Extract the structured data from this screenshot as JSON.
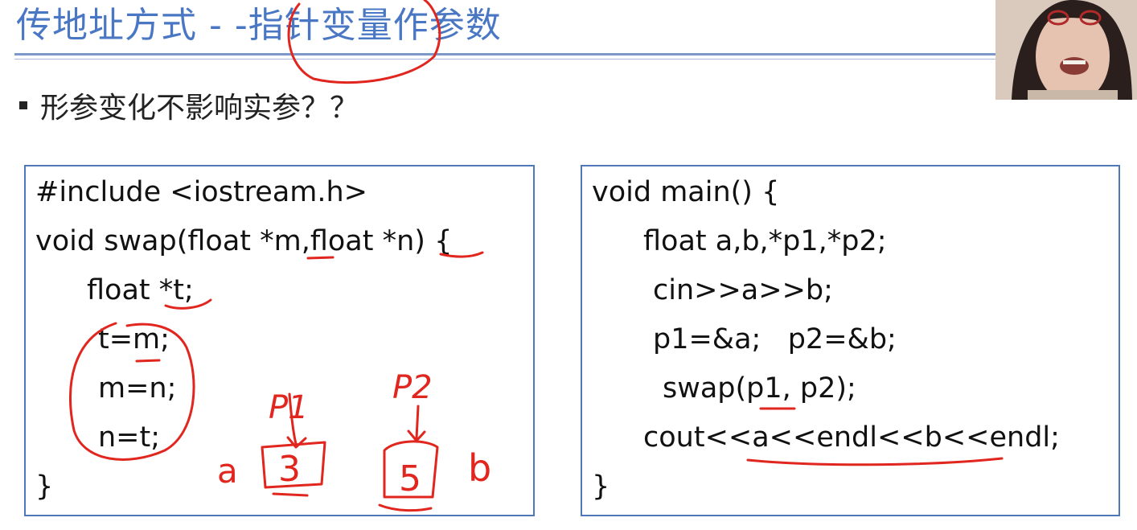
{
  "slide": {
    "title": "传地址方式 - -指针变量作参数",
    "bullet": "形参变化不影响实参？？"
  },
  "code_left": {
    "lines": [
      "#include <iostream.h>",
      "void swap(float *m,float *n) {",
      "float *t;",
      "t=m;",
      "m=n;",
      "n=t;",
      "}"
    ]
  },
  "code_right": {
    "lines": [
      "void main() {",
      "float a,b,*p1,*p2;",
      "cin>>a>>b;",
      "p1=&a;   p2=&b;",
      "swap(p1, p2);",
      "cout<<a<<endl<<b<<endl;",
      "}"
    ]
  },
  "annotations": {
    "label_a": "a",
    "label_b": "b",
    "value_a": "3",
    "value_b": "5",
    "pointer_p1": "P1",
    "pointer_p2": "P2"
  },
  "colors": {
    "title": "#4a77c4",
    "rule": "#7b98c9",
    "box_border": "#4f78b8",
    "ink": "#e0261e"
  }
}
